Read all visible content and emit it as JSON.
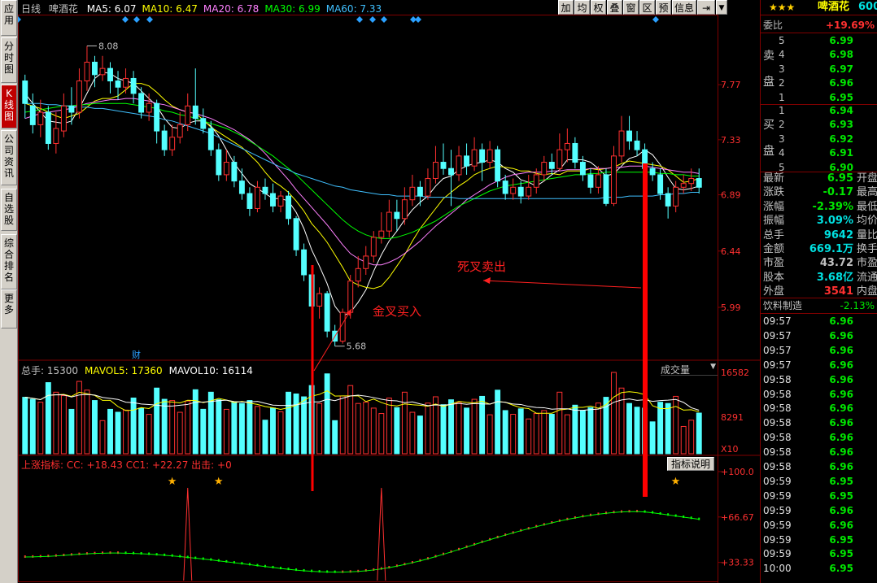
{
  "left_tabs": [
    "应用",
    "分时图",
    "K线图",
    "公司资讯",
    "自选股",
    "综合排名",
    "更多"
  ],
  "toolbar": [
    "加",
    "均",
    "权",
    "叠",
    "窗",
    "区",
    "预",
    "信息"
  ],
  "main_legend": {
    "period": "日线",
    "stock": "啤酒花",
    "items": [
      {
        "label": "MA5: 6.07",
        "color": "#ffffff"
      },
      {
        "label": "MA10: 6.47",
        "color": "#ffff00"
      },
      {
        "label": "MA20: 6.78",
        "color": "#ff80ff"
      },
      {
        "label": "MA30: 6.99",
        "color": "#00ff00"
      },
      {
        "label": "MA60: 7.33",
        "color": "#40c0ff"
      }
    ]
  },
  "price_axis": [
    "7.77",
    "7.33",
    "6.89",
    "6.44",
    "5.99"
  ],
  "price_markers": {
    "high": "8.08",
    "low": "5.68",
    "fin": "财"
  },
  "volume_legend": {
    "items": [
      {
        "label": "总手: 15300",
        "color": "#c0c0c0"
      },
      {
        "label": "MAVOL5: 17360",
        "color": "#ffff00"
      },
      {
        "label": "MAVOL10: 16114",
        "color": "#ffffff"
      }
    ],
    "selector": "成交量"
  },
  "volume_axis": [
    "16582",
    "8291",
    "X10"
  ],
  "indicator_legend": {
    "text": "上涨指标: CC: +18.43  CC1: +22.27  出击: +0",
    "button": "指标说明"
  },
  "indicator_axis": [
    "+100.0",
    "+66.67",
    "+33.33"
  ],
  "annotations": {
    "sell": "死叉卖出",
    "buy": "金叉买入"
  },
  "panel": {
    "stars": "★★★",
    "name": "啤酒花",
    "code": "600",
    "weibi_label": "委比",
    "weibi_value": "+19.69%",
    "sell_side": "卖盘",
    "buy_side": "买盘",
    "asks": [
      {
        "lvl": "5",
        "price": "6.99"
      },
      {
        "lvl": "4",
        "price": "6.98"
      },
      {
        "lvl": "3",
        "price": "6.97"
      },
      {
        "lvl": "2",
        "price": "6.96"
      },
      {
        "lvl": "1",
        "price": "6.95"
      }
    ],
    "bids": [
      {
        "lvl": "1",
        "price": "6.94"
      },
      {
        "lvl": "2",
        "price": "6.93"
      },
      {
        "lvl": "3",
        "price": "6.92"
      },
      {
        "lvl": "4",
        "price": "6.91"
      },
      {
        "lvl": "5",
        "price": "6.90"
      }
    ],
    "stats": [
      {
        "label": "最新",
        "value": "6.95",
        "color": "#00e600",
        "extra": "开盘"
      },
      {
        "label": "涨跌",
        "value": "-0.17",
        "color": "#00e600",
        "extra": "最高"
      },
      {
        "label": "涨幅",
        "value": "-2.39%",
        "color": "#00e600",
        "extra": "最低"
      },
      {
        "label": "振幅",
        "value": "3.09%",
        "color": "#00e0e0",
        "extra": "均价"
      },
      {
        "label": "总手",
        "value": "9642",
        "color": "#00e0e0",
        "extra": "量比"
      },
      {
        "label": "金额",
        "value": "669.1万",
        "color": "#00e0e0",
        "extra": "换手"
      },
      {
        "label": "市盈",
        "value": "43.72",
        "color": "#c0c0c0",
        "extra": "市盈"
      },
      {
        "label": "股本",
        "value": "3.68亿",
        "color": "#00e0e0",
        "extra": "流通"
      },
      {
        "label": "外盘",
        "value": "3541",
        "color": "#ff3030",
        "extra": "内盘"
      }
    ],
    "industry": "饮料制造",
    "industry_change": "-2.13%",
    "ticks": [
      {
        "time": "09:57",
        "price": "6.96"
      },
      {
        "time": "09:57",
        "price": "6.96"
      },
      {
        "time": "09:57",
        "price": "6.96"
      },
      {
        "time": "09:57",
        "price": "6.96"
      },
      {
        "time": "09:58",
        "price": "6.96"
      },
      {
        "time": "09:58",
        "price": "6.96"
      },
      {
        "time": "09:58",
        "price": "6.96"
      },
      {
        "time": "09:58",
        "price": "6.96"
      },
      {
        "time": "09:58",
        "price": "6.96"
      },
      {
        "time": "09:58",
        "price": "6.96"
      },
      {
        "time": "09:58",
        "price": "6.96"
      },
      {
        "time": "09:59",
        "price": "6.95"
      },
      {
        "time": "09:59",
        "price": "6.95"
      },
      {
        "time": "09:59",
        "price": "6.96"
      },
      {
        "time": "09:59",
        "price": "6.96"
      },
      {
        "time": "09:59",
        "price": "6.95"
      },
      {
        "time": "09:59",
        "price": "6.95"
      },
      {
        "time": "10:00",
        "price": "6.95"
      }
    ]
  },
  "chart_data": {
    "type": "candlestick",
    "ylim": [
      5.6,
      8.2
    ],
    "candles": [
      [
        7.8,
        7.62,
        7.85,
        7.5
      ],
      [
        7.6,
        7.45,
        7.7,
        7.38
      ],
      [
        7.45,
        7.55,
        7.65,
        7.35
      ],
      [
        7.55,
        7.3,
        7.6,
        7.25
      ],
      [
        7.3,
        7.42,
        7.55,
        7.22
      ],
      [
        7.4,
        7.6,
        7.7,
        7.35
      ],
      [
        7.6,
        7.55,
        7.75,
        7.45
      ],
      [
        7.55,
        7.8,
        7.9,
        7.5
      ],
      [
        7.8,
        7.95,
        8.08,
        7.72
      ],
      [
        7.95,
        7.85,
        8.0,
        7.75
      ],
      [
        7.85,
        7.9,
        8.0,
        7.8
      ],
      [
        7.9,
        7.8,
        7.95,
        7.7
      ],
      [
        7.8,
        7.75,
        7.88,
        7.65
      ],
      [
        7.75,
        7.82,
        7.9,
        7.7
      ],
      [
        7.82,
        7.7,
        7.88,
        7.62
      ],
      [
        7.7,
        7.55,
        7.75,
        7.5
      ],
      [
        7.55,
        7.62,
        7.7,
        7.48
      ],
      [
        7.62,
        7.4,
        7.65,
        7.3
      ],
      [
        7.4,
        7.25,
        7.45,
        7.2
      ],
      [
        7.25,
        7.35,
        7.45,
        7.2
      ],
      [
        7.35,
        7.45,
        7.55,
        7.3
      ],
      [
        7.45,
        7.6,
        7.7,
        7.4
      ],
      [
        7.6,
        7.5,
        7.9,
        7.45
      ],
      [
        7.5,
        7.42,
        7.58,
        7.38
      ],
      [
        7.42,
        7.25,
        7.48,
        7.2
      ],
      [
        7.25,
        7.05,
        7.3,
        7.0
      ],
      [
        7.05,
        7.15,
        7.25,
        7.0
      ],
      [
        7.15,
        7.0,
        7.2,
        6.95
      ],
      [
        7.0,
        6.9,
        7.1,
        6.85
      ],
      [
        6.9,
        6.78,
        6.95,
        6.72
      ],
      [
        6.78,
        6.95,
        7.0,
        6.75
      ],
      [
        6.95,
        6.9,
        7.02,
        6.85
      ],
      [
        6.9,
        6.8,
        6.98,
        6.75
      ],
      [
        6.8,
        6.88,
        6.92,
        6.75
      ],
      [
        6.88,
        6.7,
        6.92,
        6.65
      ],
      [
        6.7,
        6.45,
        6.72,
        6.4
      ],
      [
        6.45,
        6.25,
        6.5,
        6.2
      ],
      [
        6.25,
        6.0,
        6.3,
        5.95
      ],
      [
        6.0,
        6.1,
        6.15,
        5.9
      ],
      [
        6.1,
        5.8,
        6.12,
        5.75
      ],
      [
        5.8,
        5.72,
        5.85,
        5.68
      ],
      [
        5.72,
        5.95,
        5.98,
        5.7
      ],
      [
        5.95,
        6.2,
        6.25,
        5.9
      ],
      [
        6.2,
        6.3,
        6.4,
        6.15
      ],
      [
        6.3,
        6.4,
        6.48,
        6.25
      ],
      [
        6.4,
        6.55,
        6.6,
        6.35
      ],
      [
        6.55,
        6.6,
        6.75,
        6.5
      ],
      [
        6.6,
        6.75,
        6.85,
        6.55
      ],
      [
        6.75,
        6.7,
        6.85,
        6.6
      ],
      [
        6.7,
        6.85,
        6.95,
        6.65
      ],
      [
        6.85,
        6.95,
        7.05,
        6.8
      ],
      [
        6.95,
        6.88,
        7.0,
        6.8
      ],
      [
        6.88,
        7.02,
        7.1,
        6.85
      ],
      [
        7.02,
        7.15,
        7.28,
        6.98
      ],
      [
        7.15,
        7.1,
        7.3,
        7.05
      ],
      [
        7.1,
        7.05,
        7.25,
        6.8
      ],
      [
        7.05,
        7.2,
        7.28,
        7.0
      ],
      [
        7.2,
        7.12,
        7.3,
        7.05
      ],
      [
        7.12,
        7.25,
        7.35,
        7.08
      ],
      [
        7.25,
        7.15,
        7.3,
        7.0
      ],
      [
        7.15,
        7.25,
        7.32,
        7.1
      ],
      [
        7.25,
        7.0,
        7.28,
        6.95
      ],
      [
        7.0,
        6.9,
        7.05,
        6.85
      ],
      [
        6.9,
        6.95,
        7.02,
        6.85
      ],
      [
        6.95,
        6.88,
        7.0,
        6.82
      ],
      [
        6.88,
        6.95,
        7.05,
        6.85
      ],
      [
        6.95,
        7.05,
        7.1,
        6.9
      ],
      [
        7.05,
        7.15,
        7.2,
        7.0
      ],
      [
        7.15,
        7.1,
        7.22,
        7.05
      ],
      [
        7.1,
        7.25,
        7.38,
        7.08
      ],
      [
        7.25,
        7.3,
        7.42,
        7.15
      ],
      [
        7.3,
        7.15,
        7.35,
        7.1
      ],
      [
        7.15,
        7.05,
        7.2,
        7.0
      ],
      [
        7.05,
        6.95,
        7.1,
        6.9
      ],
      [
        6.95,
        7.05,
        7.12,
        6.9
      ],
      [
        7.05,
        6.82,
        7.1,
        6.8
      ],
      [
        6.82,
        7.2,
        7.28,
        6.8
      ],
      [
        7.2,
        7.4,
        7.52,
        7.15
      ],
      [
        7.4,
        7.32,
        7.52,
        7.25
      ],
      [
        7.32,
        7.25,
        7.4,
        7.2
      ],
      [
        7.25,
        7.1,
        7.3,
        7.05
      ],
      [
        7.1,
        7.05,
        7.15,
        7.0
      ],
      [
        7.05,
        6.9,
        7.1,
        6.85
      ],
      [
        6.9,
        6.8,
        6.95,
        6.7
      ],
      [
        6.8,
        6.95,
        7.0,
        6.75
      ],
      [
        6.95,
        6.98,
        7.05,
        6.9
      ],
      [
        6.98,
        7.02,
        7.1,
        6.92
      ],
      [
        7.02,
        6.95,
        7.1,
        6.9
      ]
    ],
    "ma": [
      {
        "name": "MA5",
        "color": "#ffffff",
        "values": [
          7.7,
          7.62,
          7.55,
          7.48,
          7.47,
          7.46,
          7.48,
          7.58,
          7.7,
          7.82,
          7.87,
          7.86,
          7.82,
          7.8,
          7.78,
          7.72,
          7.66,
          7.6,
          7.5,
          7.43,
          7.42,
          7.46,
          7.48,
          7.48,
          7.44,
          7.36,
          7.25,
          7.14,
          7.06,
          6.98,
          6.94,
          6.9,
          6.86,
          6.86,
          6.84,
          6.75,
          6.62,
          6.45,
          6.32,
          6.18,
          6.0,
          5.92,
          5.95,
          6.03,
          6.13,
          6.28,
          6.41,
          6.52,
          6.6,
          6.69,
          6.77,
          6.83,
          6.88,
          6.96,
          7.02,
          7.04,
          7.09,
          7.12,
          7.14,
          7.15,
          7.17,
          7.15,
          7.1,
          7.07,
          7.01,
          6.99,
          6.96,
          7.0,
          7.05,
          7.09,
          7.17,
          7.17,
          7.17,
          7.15,
          7.1,
          7.04,
          7.06,
          7.12,
          7.18,
          7.2,
          7.25,
          7.21,
          7.13,
          7.03,
          6.94,
          6.93,
          6.94,
          6.96
        ]
      },
      {
        "name": "MA10",
        "color": "#ffff00",
        "values": [
          7.62,
          7.6,
          7.58,
          7.55,
          7.52,
          7.5,
          7.52,
          7.54,
          7.59,
          7.64,
          7.66,
          7.66,
          7.68,
          7.73,
          7.78,
          7.78,
          7.76,
          7.71,
          7.65,
          7.6,
          7.57,
          7.55,
          7.54,
          7.49,
          7.43,
          7.39,
          7.35,
          7.31,
          7.27,
          7.21,
          7.15,
          7.07,
          7.0,
          6.96,
          6.91,
          6.84,
          6.76,
          6.66,
          6.59,
          6.51,
          6.41,
          6.31,
          6.2,
          6.17,
          6.15,
          6.14,
          6.16,
          6.23,
          6.32,
          6.41,
          6.52,
          6.62,
          6.7,
          6.78,
          6.86,
          6.91,
          6.96,
          7.0,
          7.05,
          7.08,
          7.1,
          7.12,
          7.11,
          7.1,
          7.08,
          7.08,
          7.06,
          7.05,
          7.06,
          7.05,
          7.08,
          7.08,
          7.08,
          7.1,
          7.09,
          7.1,
          7.11,
          7.14,
          7.16,
          7.15,
          7.14,
          7.13,
          7.12,
          7.09,
          7.04,
          6.99,
          7.0,
          7.02
        ]
      },
      {
        "name": "MA20",
        "color": "#ff80ff",
        "values": [
          7.5,
          7.52,
          7.54,
          7.55,
          7.56,
          7.57,
          7.58,
          7.6,
          7.62,
          7.63,
          7.64,
          7.65,
          7.65,
          7.66,
          7.66,
          7.65,
          7.64,
          7.62,
          7.61,
          7.59,
          7.57,
          7.55,
          7.54,
          7.52,
          7.5,
          7.47,
          7.44,
          7.41,
          7.37,
          7.33,
          7.28,
          7.22,
          7.15,
          7.08,
          7.01,
          6.93,
          6.86,
          6.79,
          6.72,
          6.65,
          6.57,
          6.49,
          6.42,
          6.38,
          6.35,
          6.33,
          6.33,
          6.35,
          6.38,
          6.42,
          6.47,
          6.52,
          6.58,
          6.64,
          6.69,
          6.74,
          6.79,
          6.85,
          6.89,
          6.93,
          6.97,
          7.0,
          7.03,
          7.05,
          7.06,
          7.07,
          7.07,
          7.07,
          7.08,
          7.08,
          7.09,
          7.09,
          7.09,
          7.1,
          7.1,
          7.1,
          7.11,
          7.11,
          7.12,
          7.12,
          7.12,
          7.11,
          7.1,
          7.09,
          7.08,
          7.07,
          7.07,
          7.06
        ]
      },
      {
        "name": "MA30",
        "color": "#00ff00",
        "values": [
          7.55,
          7.56,
          7.57,
          7.58,
          7.59,
          7.6,
          7.6,
          7.61,
          7.61,
          7.62,
          7.62,
          7.62,
          7.62,
          7.62,
          7.61,
          7.6,
          7.59,
          7.58,
          7.56,
          7.55,
          7.53,
          7.52,
          7.5,
          7.48,
          7.46,
          7.44,
          7.42,
          7.39,
          7.36,
          7.32,
          7.28,
          7.24,
          7.2,
          7.15,
          7.1,
          7.05,
          6.99,
          6.93,
          6.87,
          6.81,
          6.75,
          6.69,
          6.64,
          6.6,
          6.57,
          6.55,
          6.54,
          6.54,
          6.55,
          6.57,
          6.59,
          6.62,
          6.65,
          6.68,
          6.72,
          6.76,
          6.8,
          6.83,
          6.86,
          6.89,
          6.92,
          6.94,
          6.96,
          6.97,
          6.98,
          6.99,
          7.0,
          7.01,
          7.02,
          7.03,
          7.04,
          7.05,
          7.05,
          7.06,
          7.06,
          7.07,
          7.07,
          7.07,
          7.07,
          7.07,
          7.07,
          7.07,
          7.06,
          7.06,
          7.05,
          7.05,
          7.04,
          7.04
        ]
      },
      {
        "name": "MA60",
        "color": "#40c0ff",
        "values": [
          7.62,
          7.62,
          7.62,
          7.61,
          7.61,
          7.6,
          7.6,
          7.59,
          7.59,
          7.58,
          7.58,
          7.57,
          7.56,
          7.55,
          7.54,
          7.53,
          7.52,
          7.51,
          7.49,
          7.48,
          7.46,
          7.44,
          7.42,
          7.4,
          7.38,
          7.35,
          7.32,
          7.29,
          7.26,
          7.23,
          7.2,
          7.17,
          7.14,
          7.11,
          7.09,
          7.06,
          7.04,
          7.02,
          7.0,
          6.98,
          6.96,
          6.95,
          6.93,
          6.92,
          6.91,
          6.9,
          6.89,
          6.89,
          6.88,
          6.88,
          6.88,
          6.88,
          6.87,
          6.87,
          6.87,
          6.87,
          6.86,
          6.86,
          6.86,
          6.86,
          6.86,
          6.86,
          6.86,
          6.86,
          6.86,
          6.86,
          6.86,
          6.86,
          6.86,
          6.86,
          6.86,
          6.86,
          6.86,
          6.86,
          6.86,
          6.87,
          6.87,
          6.87,
          6.88,
          6.88,
          6.88,
          6.88,
          6.89,
          6.89,
          6.9,
          6.9,
          6.91,
          6.91
        ]
      }
    ],
    "volume_ylim": [
      0,
      16582
    ],
    "indicator_ylim": [
      20,
      100
    ],
    "indicator": {
      "CC": [
        36.7,
        36.8,
        37.0,
        37.2,
        37.5,
        37.9,
        38.3,
        38.7,
        39.0,
        39.3,
        39.5,
        39.6,
        39.6,
        39.5,
        39.3,
        39.1,
        38.8,
        38.4,
        38.0,
        37.5,
        37.0,
        36.4,
        35.8,
        35.2,
        34.6,
        33.9,
        33.2,
        32.5,
        31.8,
        31.1,
        30.4,
        29.7,
        29.0,
        28.3,
        27.7,
        27.1,
        26.6,
        26.2,
        25.9,
        25.7,
        25.6,
        25.6,
        25.8,
        26.1,
        26.6,
        27.2,
        28.0,
        28.9,
        30.0,
        31.2,
        32.5,
        33.9,
        35.4,
        37.0,
        38.7,
        40.4,
        42.2,
        44.0,
        45.8,
        47.6,
        49.4,
        51.1,
        52.8,
        54.4,
        56.0,
        57.5,
        59.0,
        60.4,
        61.8,
        63.1,
        64.3,
        65.4,
        66.4,
        67.3,
        68.1,
        68.8,
        69.4,
        69.8,
        70.0,
        70.1,
        69.8,
        69.2,
        68.4,
        67.6,
        66.8,
        66.0,
        65.2,
        64.4
      ]
    },
    "signals": {
      "yellow_runner": [
        19,
        25,
        84
      ],
      "red_spike": [
        21,
        46
      ]
    }
  }
}
